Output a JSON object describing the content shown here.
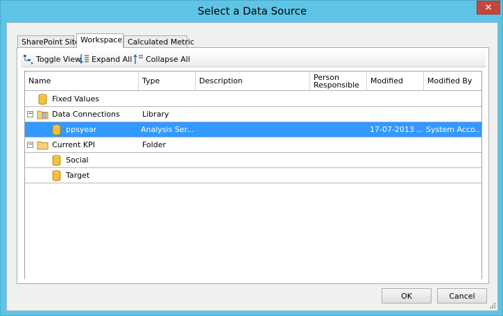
{
  "window": {
    "title": "Select a Data Source",
    "close_glyph": "✕"
  },
  "tabs": [
    {
      "label": "SharePoint Site"
    },
    {
      "label": "Workspace",
      "active": true
    },
    {
      "label": "Calculated Metric"
    }
  ],
  "toolbar": {
    "toggle_view": "Toggle View",
    "expand_all": "Expand All",
    "collapse_all": "Collapse All"
  },
  "grid": {
    "columns": {
      "name": "Name",
      "type": "Type",
      "description": "Description",
      "person": "Person Responsible",
      "modified": "Modified",
      "modified_by": "Modified By"
    },
    "rows": [
      {
        "name": "Fixed Values",
        "type": "",
        "modified": "",
        "modified_by": "",
        "icon": "database-icon"
      },
      {
        "name": "Data Connections",
        "type": "Library",
        "modified": "",
        "modified_by": "",
        "icon": "library-folder-icon",
        "expander": "−"
      },
      {
        "name": "ppsyear",
        "type": "Analysis Ser...",
        "modified": "17-07-2013 ...",
        "modified_by": "System Acco...",
        "icon": "database-icon",
        "selected": true
      },
      {
        "name": "Current KPI",
        "type": "Folder",
        "modified": "",
        "modified_by": "",
        "icon": "folder-icon",
        "expander": "−"
      },
      {
        "name": "Social",
        "type": "",
        "modified": "",
        "modified_by": "",
        "icon": "database-icon"
      },
      {
        "name": "Target",
        "type": "",
        "modified": "",
        "modified_by": "",
        "icon": "database-icon"
      }
    ]
  },
  "buttons": {
    "ok": "OK",
    "cancel": "Cancel"
  },
  "colors": {
    "title_bar": "#5ec4e6",
    "selection": "#3399ff",
    "close_button": "#c7463c"
  }
}
